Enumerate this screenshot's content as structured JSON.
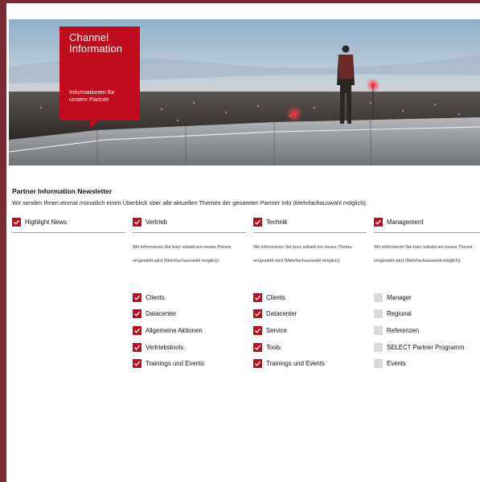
{
  "hero": {
    "title_line1": "Channel",
    "title_line2": "Information",
    "subtitle_line1": "Informationen für",
    "subtitle_line2": "unsere Partner"
  },
  "newsletter": {
    "title": "Partner Information Newsletter",
    "subtitle": "Wir senden Ihnen einmal monatlich einen Überblick über alle aktuellen Themen der gesamten Partner Info (Mehrfachauswahl möglich):"
  },
  "columns": [
    {
      "label": "Highlight News",
      "checked": true,
      "description": "",
      "items": []
    },
    {
      "label": "Vertrieb",
      "checked": true,
      "description": "Wir informieren Sie kurz sobald ein neues Thema eingestellt wird (Mehrfachauswahl möglich):",
      "items": [
        {
          "label": "Clients",
          "checked": true
        },
        {
          "label": "Datacenter",
          "checked": true
        },
        {
          "label": "Allgemeine Aktionen",
          "checked": true
        },
        {
          "label": "Vertriebstools",
          "checked": true
        },
        {
          "label": "Trainings und Events",
          "checked": true
        }
      ]
    },
    {
      "label": "Technik",
      "checked": true,
      "description": "Wir informieren Sie kurz sobald ein neues Thema eingestellt wird (Mehrfachauswahl möglich):",
      "items": [
        {
          "label": "Clients",
          "checked": true
        },
        {
          "label": "Datacenter",
          "checked": true
        },
        {
          "label": "Service",
          "checked": true
        },
        {
          "label": "Tools",
          "checked": true
        },
        {
          "label": "Trainings und Events",
          "checked": true
        }
      ]
    },
    {
      "label": "Management",
      "checked": true,
      "description": "Wir informieren Sie kurz sobald ein neues Thema eingestellt wird (Mehrfachauswahl möglich):",
      "items": [
        {
          "label": "Manager",
          "checked": false
        },
        {
          "label": "Regional",
          "checked": false
        },
        {
          "label": "Referenzen",
          "checked": false
        },
        {
          "label": "SELECT Partner Programm",
          "checked": false
        },
        {
          "label": "Events",
          "checked": false
        }
      ]
    }
  ],
  "colors": {
    "accent": "#c00c1d",
    "frame": "#7a2a33",
    "unchecked": "#d9d9d9"
  },
  "icons": {
    "checkbox_checked": "check-icon"
  }
}
